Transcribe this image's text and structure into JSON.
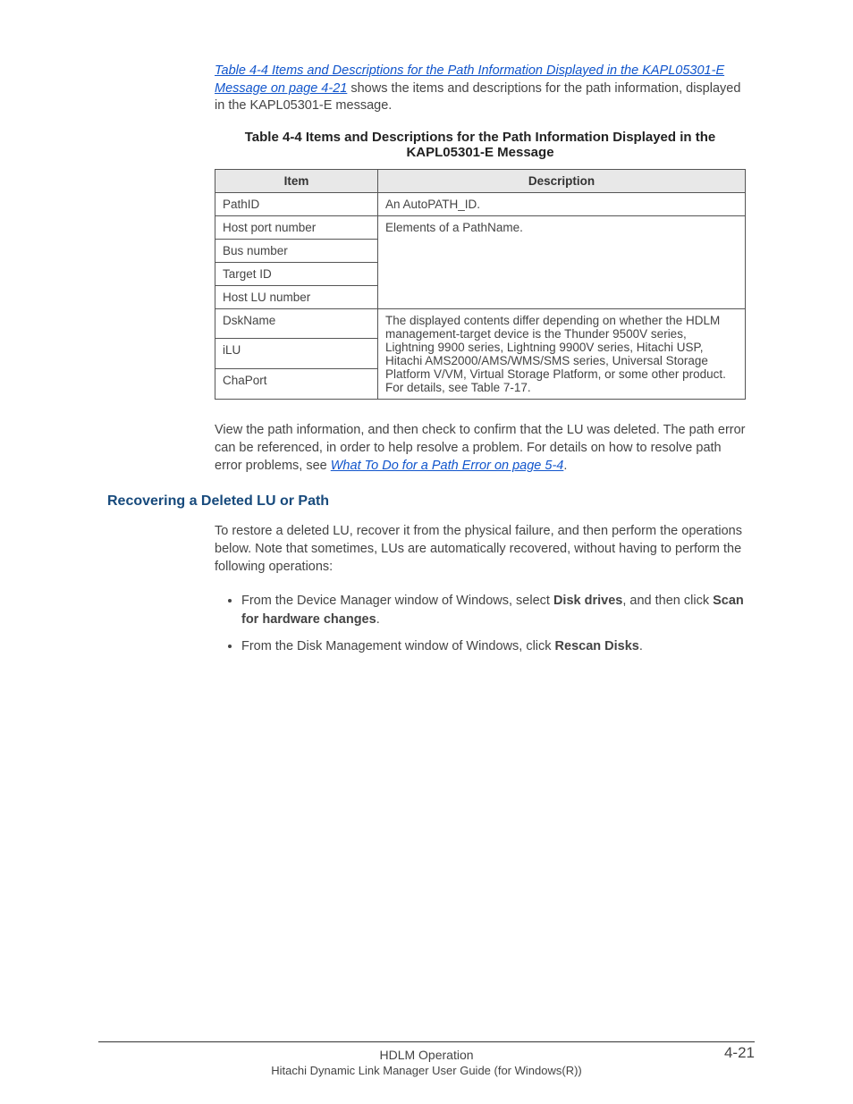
{
  "intro": {
    "link_text": "Table 4-4 Items and Descriptions for the Path Information Displayed in the KAPL05301-E Message on page 4-21",
    "after_link": " shows the items and descriptions for the path information, displayed in the KAPL05301-E message."
  },
  "table": {
    "title": "Table 4-4 Items and Descriptions for the Path Information Displayed in the KAPL05301-E Message",
    "headers": {
      "col1": "Item",
      "col2": "Description"
    },
    "rows": {
      "r1": {
        "item": "PathID",
        "desc": "An AutoPATH_ID."
      },
      "r2": {
        "item": "Host port number",
        "desc": "Elements of a PathName."
      },
      "r3": {
        "item": "Bus number"
      },
      "r4": {
        "item": "Target ID"
      },
      "r5": {
        "item": "Host LU number"
      },
      "r6": {
        "item": "DskName",
        "desc": "The displayed contents differ depending on whether the HDLM management-target device is the Thunder 9500V series, Lightning 9900 series, Lightning 9900V series, Hitachi USP, Hitachi AMS2000/AMS/WMS/SMS series, Universal Storage Platform V/VM, Virtual Storage Platform, or some other product. For details, see Table 7-17."
      },
      "r7": {
        "item": "iLU"
      },
      "r8": {
        "item": "ChaPort"
      }
    }
  },
  "after_table": {
    "text_before_link": "View the path information, and then check to confirm that the LU was deleted. The path error can be referenced, in order to help resolve a problem. For details on how to resolve path error problems, see ",
    "link_text": "What To Do for a Path Error on page 5-4",
    "text_after_link": "."
  },
  "section": {
    "heading": "Recovering a Deleted LU or Path",
    "para": "To restore a deleted LU, recover it from the physical failure, and then perform the operations below. Note that sometimes, LUs are automatically recovered, without having to perform the following operations:",
    "bullets": {
      "b1": {
        "t1": "From the Device Manager window of Windows, select ",
        "b1": "Disk drives",
        "t2": ", and then click ",
        "b2": "Scan for hardware changes",
        "t3": "."
      },
      "b2": {
        "t1": "From the Disk Management window of Windows, click ",
        "b1": "Rescan Disks",
        "t2": "."
      }
    }
  },
  "footer": {
    "line1": "HDLM Operation",
    "line2": "Hitachi Dynamic Link Manager User Guide (for Windows(R))",
    "pagenum": "4-21"
  }
}
